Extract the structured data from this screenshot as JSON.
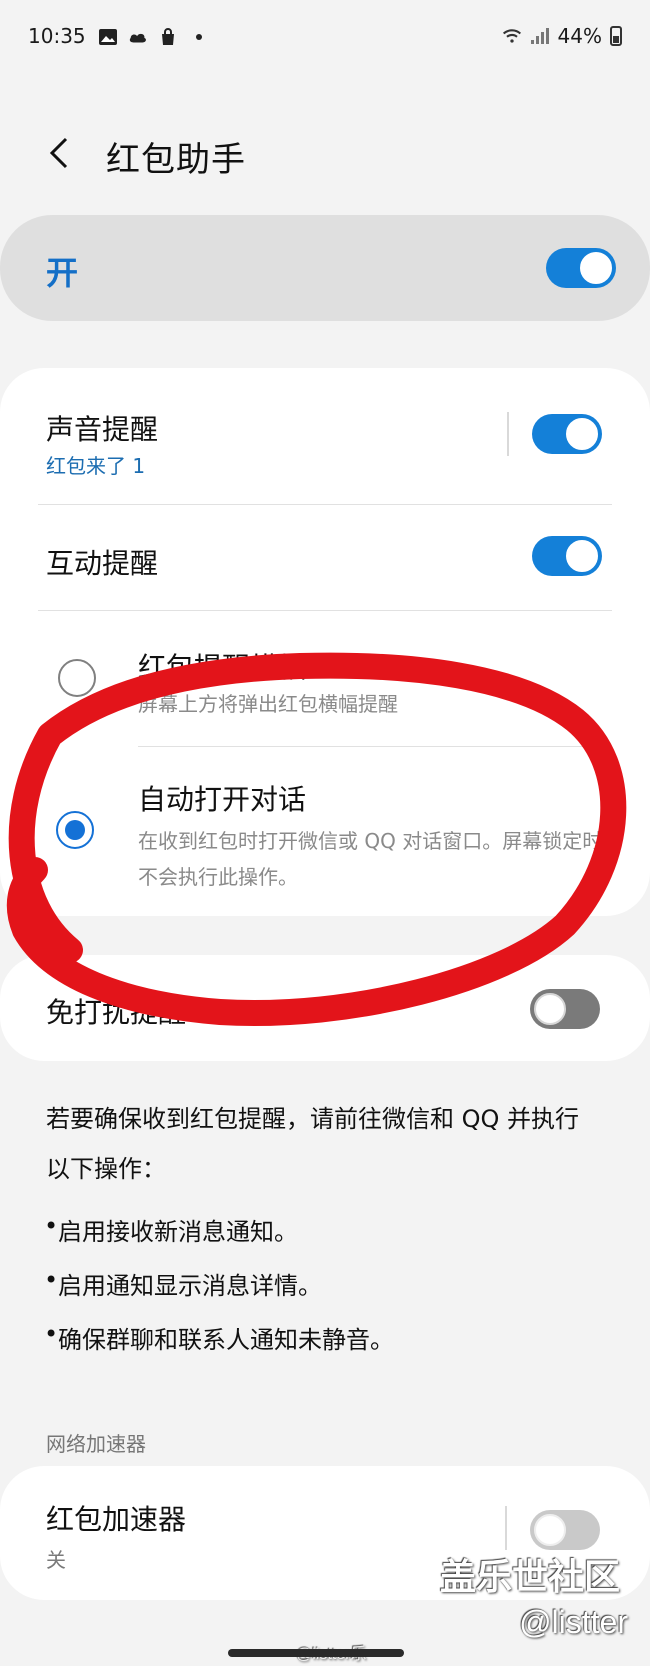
{
  "status_bar": {
    "time": "10:35",
    "battery": "44%"
  },
  "header": {
    "title": "红包助手"
  },
  "master": {
    "label": "开",
    "state": "on"
  },
  "card1": {
    "sound_label": "声音提醒",
    "sound_sub": "红包来了 1",
    "interactive_label": "互动提醒",
    "options": [
      {
        "title": "红包提醒横幅",
        "desc": "屏幕上方将弹出红包横幅提醒",
        "selected": false
      },
      {
        "title": "自动打开对话",
        "desc": "在收到红包时打开微信或 QQ 对话窗口。屏幕锁定时不会执行此操作。",
        "selected": true
      }
    ]
  },
  "card2": {
    "dnd_label": "免打扰提醒"
  },
  "info": {
    "text": "若要确保收到红包提醒，请前往微信和 QQ 并执行以下操作：",
    "bullets": [
      "启用接收新消息通知。",
      "启用通知显示消息详情。",
      "确保群聊和联系人通知未静音。"
    ]
  },
  "network": {
    "section_title": "网络加速器",
    "booster_label": "红包加速器",
    "booster_sub": "关"
  },
  "watermarks": {
    "line1": "盖乐世社区",
    "line2": "@listter",
    "line3": "@listter乐"
  },
  "colors": {
    "accent": "#1480d8",
    "annotation": "#e3141a"
  }
}
